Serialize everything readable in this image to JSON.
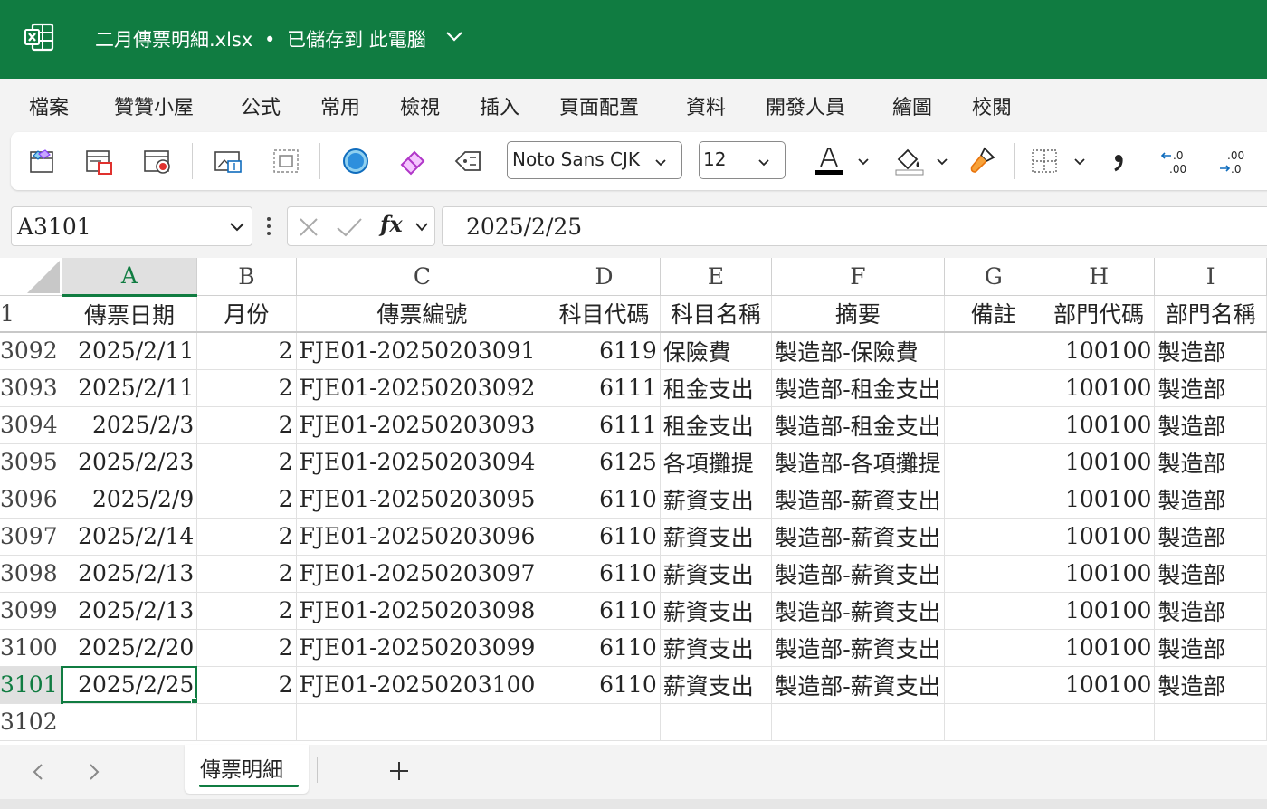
{
  "titlebar": {
    "filename": "二月傳票明細.xlsx",
    "separator": "•",
    "save_status": "已儲存到 此電腦",
    "app_icon": "excel-icon"
  },
  "menu": [
    "檔案",
    "贊贊小屋",
    "公式",
    "常用",
    "檢視",
    "插入",
    "頁面配置",
    "資料",
    "開發人員",
    "繪圖",
    "校閱"
  ],
  "ribbon": {
    "font_name": "Noto Sans CJK",
    "font_size": "12",
    "font_color": "#000000",
    "icons": [
      "pivot-table-icon",
      "insert-report-icon",
      "record-macro-icon",
      "insert-picture-icon",
      "select-object-icon",
      "shape-circle-icon",
      "eraser-icon",
      "tag-icon",
      "font-color-icon",
      "fill-color-icon",
      "format-painter-icon",
      "borders-icon",
      "comma-style-icon",
      "decrease-decimal-icon",
      "increase-decimal-icon"
    ]
  },
  "formula_bar": {
    "name_box": "A3101",
    "formula": "2025/2/25",
    "fx_label": "fx"
  },
  "grid": {
    "columns": [
      "A",
      "B",
      "C",
      "D",
      "E",
      "F",
      "G",
      "H",
      "I"
    ],
    "selected_column": "A",
    "header_row_number": "1",
    "headers": [
      "傳票日期",
      "月份",
      "傳票編號",
      "科目代碼",
      "科目名稱",
      "摘要",
      "備註",
      "部門代碼",
      "部門名稱"
    ],
    "rows": [
      {
        "row": "3092",
        "date": "2025/2/11",
        "month": "2",
        "voucher": "FJE01-20250203091",
        "code": "6119",
        "account": "保險費",
        "summary": "製造部-保險費",
        "note": "",
        "dept_code": "100100",
        "dept_name": "製造部"
      },
      {
        "row": "3093",
        "date": "2025/2/11",
        "month": "2",
        "voucher": "FJE01-20250203092",
        "code": "6111",
        "account": "租金支出",
        "summary": "製造部-租金支出",
        "note": "",
        "dept_code": "100100",
        "dept_name": "製造部"
      },
      {
        "row": "3094",
        "date": "2025/2/3",
        "month": "2",
        "voucher": "FJE01-20250203093",
        "code": "6111",
        "account": "租金支出",
        "summary": "製造部-租金支出",
        "note": "",
        "dept_code": "100100",
        "dept_name": "製造部"
      },
      {
        "row": "3095",
        "date": "2025/2/23",
        "month": "2",
        "voucher": "FJE01-20250203094",
        "code": "6125",
        "account": "各項攤提",
        "summary": "製造部-各項攤提",
        "note": "",
        "dept_code": "100100",
        "dept_name": "製造部"
      },
      {
        "row": "3096",
        "date": "2025/2/9",
        "month": "2",
        "voucher": "FJE01-20250203095",
        "code": "6110",
        "account": "薪資支出",
        "summary": "製造部-薪資支出",
        "note": "",
        "dept_code": "100100",
        "dept_name": "製造部"
      },
      {
        "row": "3097",
        "date": "2025/2/14",
        "month": "2",
        "voucher": "FJE01-20250203096",
        "code": "6110",
        "account": "薪資支出",
        "summary": "製造部-薪資支出",
        "note": "",
        "dept_code": "100100",
        "dept_name": "製造部"
      },
      {
        "row": "3098",
        "date": "2025/2/13",
        "month": "2",
        "voucher": "FJE01-20250203097",
        "code": "6110",
        "account": "薪資支出",
        "summary": "製造部-薪資支出",
        "note": "",
        "dept_code": "100100",
        "dept_name": "製造部"
      },
      {
        "row": "3099",
        "date": "2025/2/13",
        "month": "2",
        "voucher": "FJE01-20250203098",
        "code": "6110",
        "account": "薪資支出",
        "summary": "製造部-薪資支出",
        "note": "",
        "dept_code": "100100",
        "dept_name": "製造部"
      },
      {
        "row": "3100",
        "date": "2025/2/20",
        "month": "2",
        "voucher": "FJE01-20250203099",
        "code": "6110",
        "account": "薪資支出",
        "summary": "製造部-薪資支出",
        "note": "",
        "dept_code": "100100",
        "dept_name": "製造部"
      },
      {
        "row": "3101",
        "date": "2025/2/25",
        "month": "2",
        "voucher": "FJE01-20250203100",
        "code": "6110",
        "account": "薪資支出",
        "summary": "製造部-薪資支出",
        "note": "",
        "dept_code": "100100",
        "dept_name": "製造部"
      }
    ],
    "empty_row": "3102",
    "active_row": "3101"
  },
  "sheets": {
    "active": "傳票明細",
    "add_label": "+"
  },
  "colors": {
    "brand": "#107c41",
    "accent_red": "#e0312e",
    "accent_blue": "#0f6cbd",
    "accent_purple": "#8a3ffc",
    "accent_orange": "#e8730c"
  }
}
